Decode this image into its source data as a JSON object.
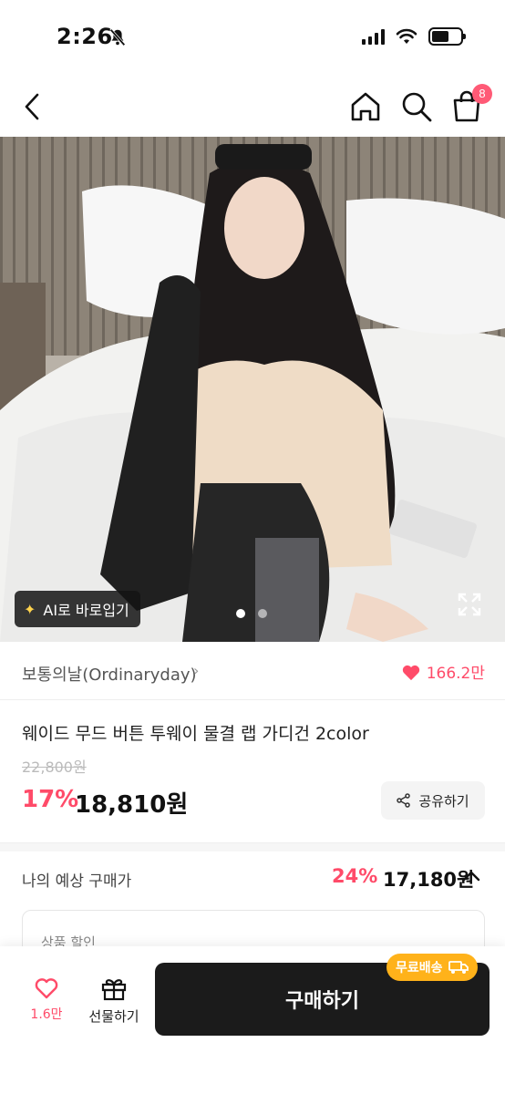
{
  "status_bar": {
    "time": "2:26"
  },
  "nav": {
    "cart_count": "8"
  },
  "hero": {
    "ai_fit_label": "AI로 바로입기",
    "page_indicator": {
      "current": 1,
      "total": 2
    }
  },
  "brand": {
    "name": "보통의날(Ordinaryday)",
    "likes": "166.2만"
  },
  "product": {
    "title": "웨이드 무드 버튼 투웨이 물결 랩 가디건 2color",
    "original_price": "22,800원",
    "discount_rate": "17%",
    "price": "18,810원",
    "share_label": "공유하기"
  },
  "expected": {
    "label": "나의 예상 구매가",
    "rate": "24%",
    "price": "17,180원"
  },
  "discount_card": {
    "label": "상품 할인"
  },
  "bottom_bar": {
    "wish_count": "1.6만",
    "gift_label": "선물하기",
    "buy_label": "구매하기",
    "free_shipping_label": "무료배송"
  },
  "colors": {
    "accent_pink": "#ff4b69",
    "badge_pink": "#ff5a76",
    "buy_button": "#1b1b1b",
    "free_shipping": "#ffb21a"
  }
}
